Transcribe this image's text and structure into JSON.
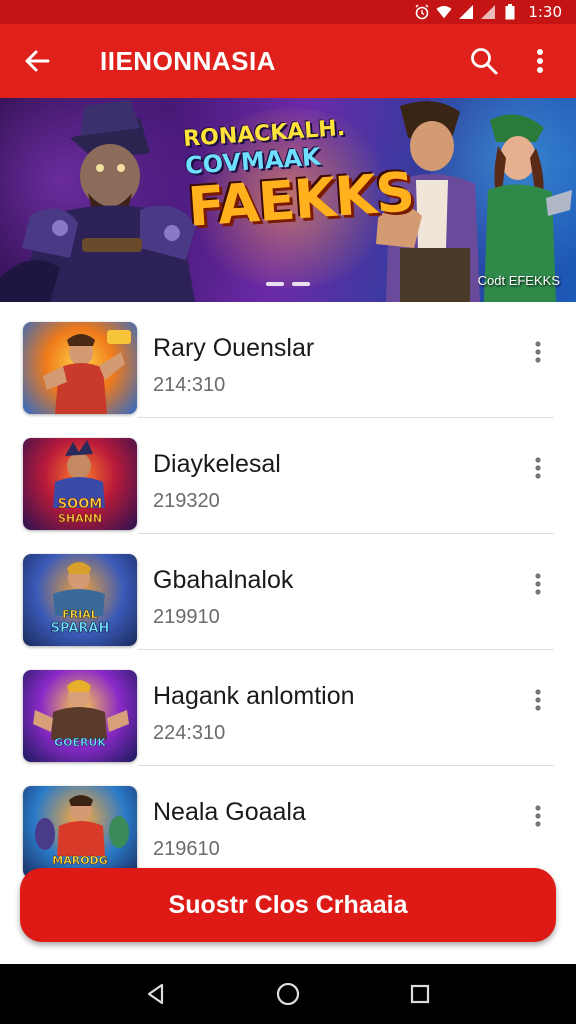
{
  "status_bar": {
    "time": "1:30",
    "icons": [
      "alarm-icon",
      "wifi-icon",
      "signal-icon",
      "signal-icon",
      "battery-icon"
    ]
  },
  "app_bar": {
    "title": "IIENONNASIA",
    "back_icon": "arrow-back-icon",
    "actions": [
      "search-icon",
      "more-vert-icon"
    ]
  },
  "banner": {
    "headline_line1": "RONACKALH.",
    "headline_line2": "COVMAAK",
    "headline_line3": "FAEKKS",
    "caption": "Codt EFEKKS",
    "page_count": 2
  },
  "colors": {
    "primary": "#e0201a",
    "status_bar": "#c41414",
    "button": "#dd1a16"
  },
  "list": {
    "items": [
      {
        "name": "Rary Ouenslar",
        "meta": "214:310"
      },
      {
        "name": "Diaykelesal",
        "meta": "219320"
      },
      {
        "name": "Gbahalnalok",
        "meta": "219910"
      },
      {
        "name": "Hagank anlomtion",
        "meta": "224:310"
      },
      {
        "name": "Neala Goaala",
        "meta": "219610"
      }
    ]
  },
  "thumbnails": [
    {
      "label": ""
    },
    {
      "label": "SOOM\nSHANN"
    },
    {
      "label": "FRIAL\nSPARAH"
    },
    {
      "label": "GOERUK"
    },
    {
      "label": "MARODG"
    }
  ],
  "action_button": {
    "label": "Suostr Clos Crhaaia"
  },
  "nav_bar": {
    "buttons": [
      "back-triangle-icon",
      "home-circle-icon",
      "recents-square-icon"
    ]
  }
}
